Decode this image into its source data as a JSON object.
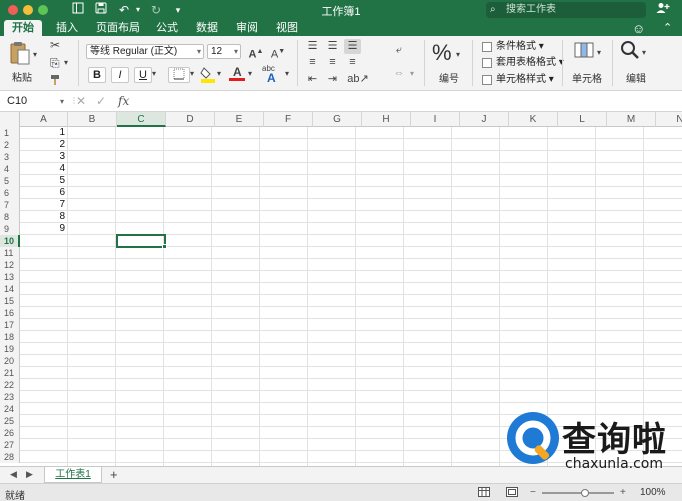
{
  "window": {
    "title": "工作簿1",
    "search_placeholder": "搜索工作表",
    "accent_color": "#217346"
  },
  "tabs": [
    "开始",
    "插入",
    "页面布局",
    "公式",
    "数据",
    "审阅",
    "视图"
  ],
  "ribbon": {
    "paste_label": "粘贴",
    "font_name": "等线 Regular (正文)",
    "font_size": "12",
    "grow_font": "A",
    "shrink_font": "A",
    "bold": "B",
    "italic": "I",
    "underline": "U",
    "font_color_glyph": "A",
    "abc_glyph": "abc",
    "number_label": "编号",
    "percent_glyph": "%",
    "conditional_format": "条件格式",
    "format_as_table": "套用表格格式",
    "cell_styles": "单元格样式",
    "cells_label": "单元格",
    "editing_label": "编辑"
  },
  "formula_bar": {
    "name_box": "C10",
    "fx": "fx",
    "formula": ""
  },
  "grid": {
    "columns": [
      "A",
      "B",
      "C",
      "D",
      "E",
      "F",
      "G",
      "H",
      "I",
      "J",
      "K",
      "L",
      "M",
      "N"
    ],
    "rows": [
      "1",
      "2",
      "3",
      "4",
      "5",
      "6",
      "7",
      "8",
      "9",
      "10",
      "11",
      "12",
      "13",
      "14",
      "15",
      "16",
      "17",
      "18",
      "19",
      "20",
      "21",
      "22",
      "23",
      "24",
      "25",
      "26",
      "27",
      "28"
    ],
    "column_a_values": [
      "1",
      "2",
      "3",
      "4",
      "5",
      "6",
      "7",
      "8",
      "9"
    ],
    "active_column": "C",
    "active_row": "10"
  },
  "sheets": {
    "tabs": [
      "工作表1"
    ],
    "add": "+"
  },
  "status": {
    "text": "就绪",
    "zoom": "100%",
    "zoom_fraction": 0.6
  },
  "watermark": {
    "chinese": "查询啦",
    "english": "chaxunla.com"
  }
}
